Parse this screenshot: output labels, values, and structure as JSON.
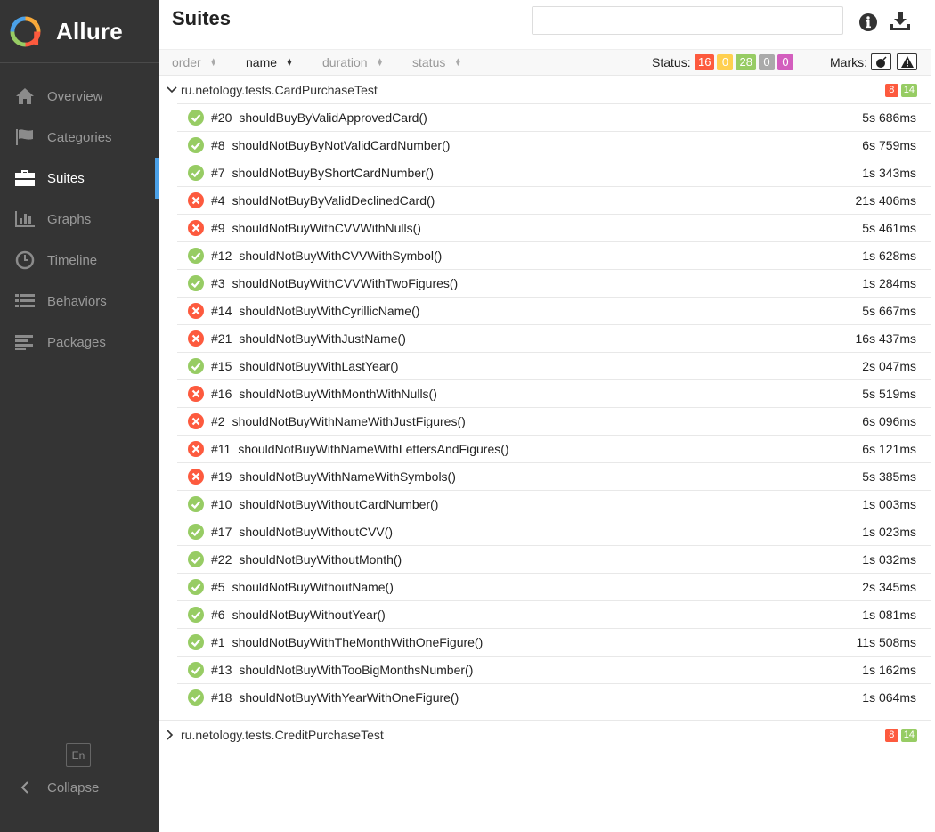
{
  "app": {
    "name": "Allure"
  },
  "sidebar": {
    "items": [
      {
        "label": "Overview",
        "icon": "home-icon",
        "active": false
      },
      {
        "label": "Categories",
        "icon": "flag-icon",
        "active": false
      },
      {
        "label": "Suites",
        "icon": "briefcase-icon",
        "active": true
      },
      {
        "label": "Graphs",
        "icon": "bar-chart-icon",
        "active": false
      },
      {
        "label": "Timeline",
        "icon": "clock-icon",
        "active": false
      },
      {
        "label": "Behaviors",
        "icon": "list-icon",
        "active": false
      },
      {
        "label": "Packages",
        "icon": "align-left-icon",
        "active": false
      }
    ],
    "language": "En",
    "collapse_label": "Collapse"
  },
  "header": {
    "title": "Suites",
    "search_value": ""
  },
  "toolbar": {
    "sort": [
      {
        "label": "order"
      },
      {
        "label": "name"
      },
      {
        "label": "duration"
      },
      {
        "label": "status"
      }
    ],
    "status_label": "Status:",
    "status_counts": [
      {
        "value": "16",
        "color": "#fd5a3e"
      },
      {
        "value": "0",
        "color": "#ffd050"
      },
      {
        "value": "28",
        "color": "#97cc64"
      },
      {
        "value": "0",
        "color": "#aaaaaa"
      },
      {
        "value": "0",
        "color": "#d35ebe"
      }
    ],
    "marks_label": "Marks:"
  },
  "groups": [
    {
      "name": "ru.netology.tests.CardPurchaseTest",
      "failed": "8",
      "passed": "14",
      "expanded": true,
      "tests": [
        {
          "num": "#20",
          "name": "shouldBuyByValidApprovedCard()",
          "duration": "5s 686ms",
          "status": "passed"
        },
        {
          "num": "#8",
          "name": "shouldNotBuyByNotValidCardNumber()",
          "duration": "6s 759ms",
          "status": "passed"
        },
        {
          "num": "#7",
          "name": "shouldNotBuyByShortCardNumber()",
          "duration": "1s 343ms",
          "status": "passed"
        },
        {
          "num": "#4",
          "name": "shouldNotBuyByValidDeclinedCard()",
          "duration": "21s 406ms",
          "status": "failed"
        },
        {
          "num": "#9",
          "name": "shouldNotBuyWithCVVWithNulls()",
          "duration": "5s 461ms",
          "status": "failed"
        },
        {
          "num": "#12",
          "name": "shouldNotBuyWithCVVWithSymbol()",
          "duration": "1s 628ms",
          "status": "passed"
        },
        {
          "num": "#3",
          "name": "shouldNotBuyWithCVVWithTwoFigures()",
          "duration": "1s 284ms",
          "status": "passed"
        },
        {
          "num": "#14",
          "name": "shouldNotBuyWithCyrillicName()",
          "duration": "5s 667ms",
          "status": "failed"
        },
        {
          "num": "#21",
          "name": "shouldNotBuyWithJustName()",
          "duration": "16s 437ms",
          "status": "failed"
        },
        {
          "num": "#15",
          "name": "shouldNotBuyWithLastYear()",
          "duration": "2s 047ms",
          "status": "passed"
        },
        {
          "num": "#16",
          "name": "shouldNotBuyWithMonthWithNulls()",
          "duration": "5s 519ms",
          "status": "failed"
        },
        {
          "num": "#2",
          "name": "shouldNotBuyWithNameWithJustFigures()",
          "duration": "6s 096ms",
          "status": "failed"
        },
        {
          "num": "#11",
          "name": "shouldNotBuyWithNameWithLettersAndFigures()",
          "duration": "6s 121ms",
          "status": "failed"
        },
        {
          "num": "#19",
          "name": "shouldNotBuyWithNameWithSymbols()",
          "duration": "5s 385ms",
          "status": "failed"
        },
        {
          "num": "#10",
          "name": "shouldNotBuyWithoutCardNumber()",
          "duration": "1s 003ms",
          "status": "passed"
        },
        {
          "num": "#17",
          "name": "shouldNotBuyWithoutCVV()",
          "duration": "1s 023ms",
          "status": "passed"
        },
        {
          "num": "#22",
          "name": "shouldNotBuyWithoutMonth()",
          "duration": "1s 032ms",
          "status": "passed"
        },
        {
          "num": "#5",
          "name": "shouldNotBuyWithoutName()",
          "duration": "2s 345ms",
          "status": "passed"
        },
        {
          "num": "#6",
          "name": "shouldNotBuyWithoutYear()",
          "duration": "1s 081ms",
          "status": "passed"
        },
        {
          "num": "#1",
          "name": "shouldNotBuyWithTheMonthWithOneFigure()",
          "duration": "11s 508ms",
          "status": "passed"
        },
        {
          "num": "#13",
          "name": "shouldNotBuyWithTooBigMonthsNumber()",
          "duration": "1s 162ms",
          "status": "passed"
        },
        {
          "num": "#18",
          "name": "shouldNotBuyWithYearWithOneFigure()",
          "duration": "1s 064ms",
          "status": "passed"
        }
      ]
    },
    {
      "name": "ru.netology.tests.CreditPurchaseTest",
      "failed": "8",
      "passed": "14",
      "expanded": false,
      "tests": []
    }
  ],
  "colors": {
    "failed": "#fd5a3e",
    "passed": "#97cc64",
    "accent": "#4ba1e8",
    "sidebar_bg": "#343434"
  }
}
